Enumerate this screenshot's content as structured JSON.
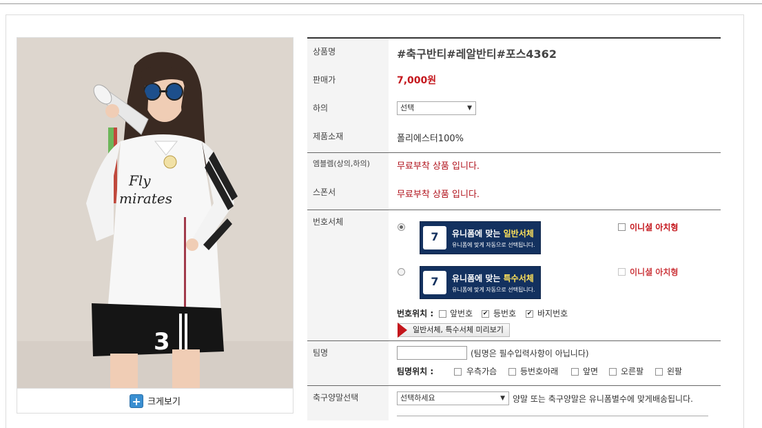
{
  "product": {
    "name": "#축구반티#레알반티#포스4362",
    "zoom_label": "크게보기",
    "jersey_text": "Fly Emirates",
    "jersey_number": "3"
  },
  "fields": {
    "name_label": "상품명",
    "price_label": "판매가",
    "price": "7,000원",
    "bottom_label": "하의",
    "bottom_select": "선택",
    "material_label": "제품소재",
    "material": "폴리에스터100%",
    "emblem_label": "엠블렘(상의,하의)",
    "emblem_value": "무료부착 상품 입니다.",
    "sponsor_label": "스폰서",
    "sponsor_value": "무료부착 상품 입니다."
  },
  "font_section": {
    "label": "번호서체",
    "options": [
      {
        "selected": true,
        "banner_line1_prefix": "유니폼에 맞는 ",
        "banner_line1_highlight": "일반서체",
        "banner_line2": "유니폼에 맞게 자동으로 선택됩니다.",
        "initial_label": "이니셜 아치형",
        "initial_checked": false
      },
      {
        "selected": false,
        "banner_line1_prefix": "유니폼에 맞는 ",
        "banner_line1_highlight": "특수서체",
        "banner_line2": "유니폼에 맞게 자동으로 선택됩니다.",
        "initial_label": "이니셜 아치형",
        "initial_checked": false
      }
    ],
    "banner_shirt_number": "7",
    "position_label": "번호위치 :",
    "positions": [
      {
        "label": "앞번호",
        "checked": false
      },
      {
        "label": "등번호",
        "checked": true
      },
      {
        "label": "바지번호",
        "checked": true
      }
    ],
    "preview_button": "일반서체, 특수서체 미리보기"
  },
  "team_section": {
    "label": "팀명",
    "input_value": "",
    "hint": "(팀명은 필수입력사항이 아닙니다)",
    "position_label": "팀명위치 :",
    "positions": [
      {
        "label": "우측가슴",
        "checked": false
      },
      {
        "label": "등번호아래",
        "checked": false
      },
      {
        "label": "앞면",
        "checked": false
      },
      {
        "label": "오른팔",
        "checked": false
      },
      {
        "label": "왼팔",
        "checked": false
      }
    ]
  },
  "socks_section": {
    "label": "축구양말선택",
    "select_value": "선택하세요",
    "note": "양말 또는 축구양말은 유니폼별수에 맞게배송됩니다."
  },
  "colors": {
    "price_red": "#c4161c",
    "banner_navy": "#13315f",
    "highlight_yellow": "#ffe25a"
  }
}
